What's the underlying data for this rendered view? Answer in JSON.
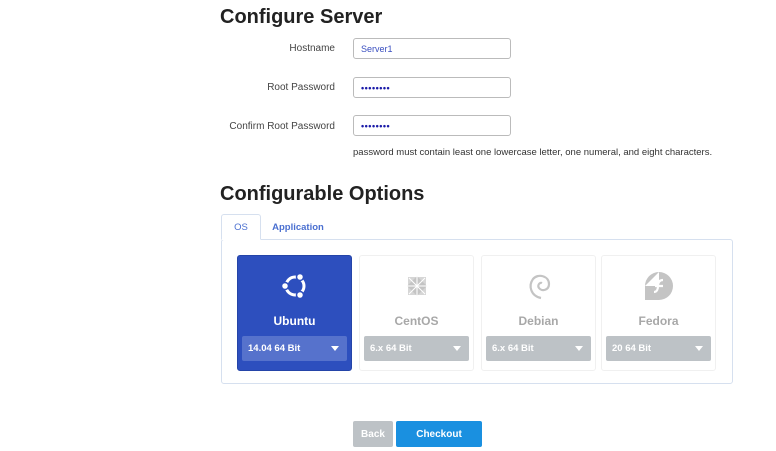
{
  "configure": {
    "title": "Configure Server",
    "fields": [
      {
        "label": "Hostname",
        "value": "Server1"
      },
      {
        "label": "Root Password",
        "value": "••••••••"
      },
      {
        "label": "Confirm Root Password",
        "value": "••••••••"
      }
    ],
    "hint": "password must contain least one lowercase letter, one numeral, and eight characters."
  },
  "options": {
    "title": "Configurable Options",
    "tabs": [
      {
        "label": "OS",
        "active": true
      },
      {
        "label": "Application",
        "active": false
      }
    ],
    "os": [
      {
        "name": "Ubuntu",
        "version": "14.04 64 Bit",
        "icon": "ubuntu-icon",
        "selected": true
      },
      {
        "name": "CentOS",
        "version": "6.x 64 Bit",
        "icon": "centos-icon",
        "selected": false
      },
      {
        "name": "Debian",
        "version": "6.x 64 Bit",
        "icon": "debian-icon",
        "selected": false
      },
      {
        "name": "Fedora",
        "version": "20 64 Bit",
        "icon": "fedora-icon",
        "selected": false
      }
    ]
  },
  "actions": {
    "back": "Back",
    "checkout": "Checkout"
  },
  "colors": {
    "accent": "#2d4fbe",
    "checkout": "#1a90e0",
    "back": "#bdc2c6"
  }
}
